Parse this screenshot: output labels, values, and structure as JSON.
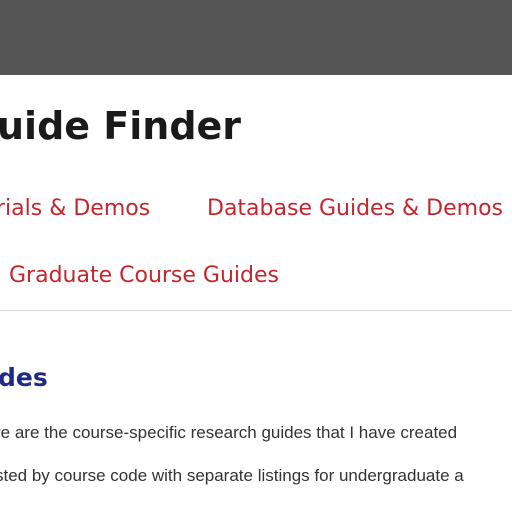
{
  "header": {
    "title": "uide Finder"
  },
  "nav": {
    "links": [
      "rials & Demos",
      "Database Guides & Demos",
      "Graduate Course Guides"
    ]
  },
  "content": {
    "heading": "des",
    "paragraph_lines": [
      "re are the course-specific research guides that I have created",
      "sted by course code with separate listings for undergraduate a"
    ]
  },
  "colors": {
    "top_bar": "#545454",
    "link": "#c4262e",
    "heading": "#1f2a86",
    "text": "#333333"
  }
}
